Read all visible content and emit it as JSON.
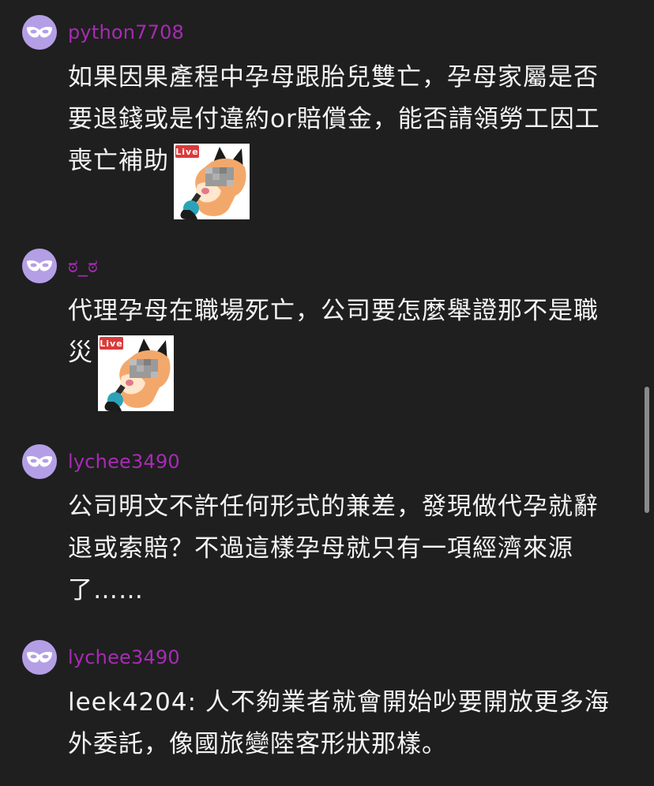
{
  "comments": [
    {
      "username": "python7708",
      "text": "如果因果產程中孕母跟胎兒雙亡，孕母家屬是否要退錢或是付違約or賠償金，能否請領勞工因工喪亡補助",
      "sticker": {
        "icon": "fox-reporter-sticker",
        "badge": "Live"
      }
    },
    {
      "username": "ಠ_ಠ",
      "text": "代理孕母在職場死亡，公司要怎麼舉證那不是職災",
      "sticker": {
        "icon": "fox-reporter-sticker",
        "badge": "Live"
      }
    },
    {
      "username": "lychee3490",
      "text": "公司明文不許任何形式的兼差，發現做代孕就辭退或索賠？不過這樣孕母就只有一項經濟來源了……"
    },
    {
      "username": "lychee3490",
      "text": "leek4204: 人不夠業者就會開始吵要開放更多海外委託，像國旅變陸客形狀那樣。"
    }
  ],
  "avatar_icon": "mask-icon",
  "colors": {
    "background": "#1f1f1f",
    "username": "#a72bb4",
    "avatar": "#b49fe6",
    "text": "#f4f4f4"
  }
}
